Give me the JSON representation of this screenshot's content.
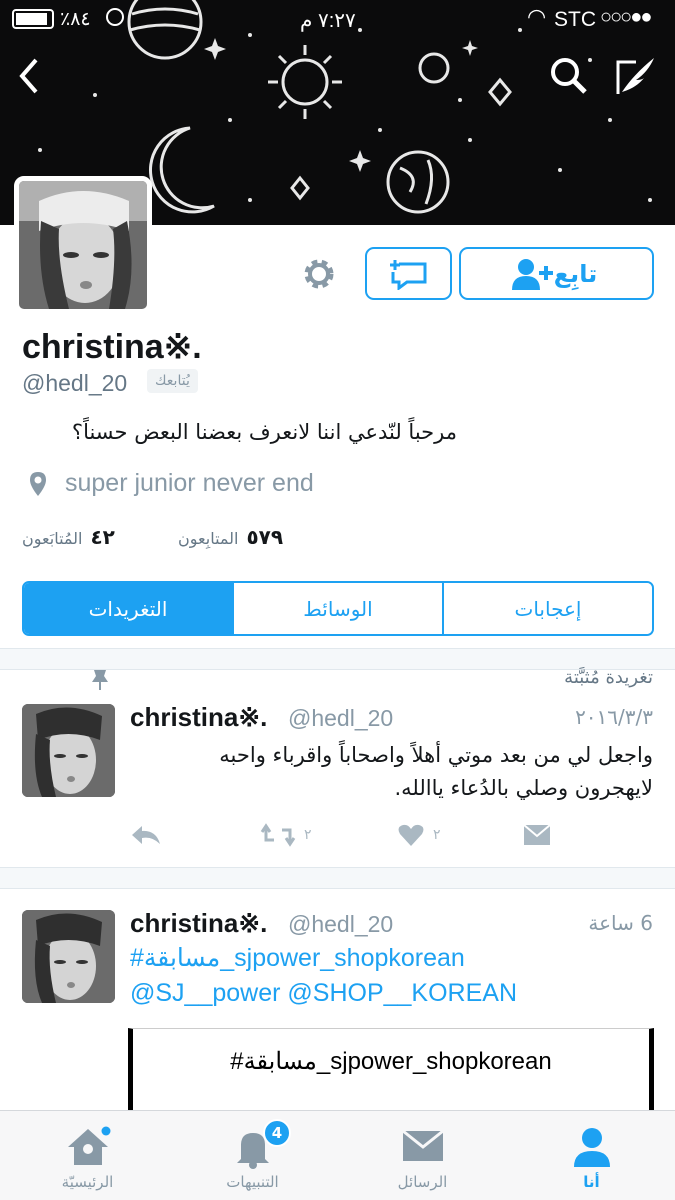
{
  "status_bar": {
    "battery": "٪٨٤",
    "time": "٧:٢٧ م",
    "carrier": "STC"
  },
  "header": {
    "back_icon": "chevron-left-icon",
    "search_icon": "search-icon",
    "compose_icon": "compose-icon"
  },
  "profile": {
    "follow_label": "تابِع",
    "name": "christina※.",
    "handle": "@hedl_20",
    "follows_you": "يُتابعك",
    "bio": "مرحباً لنّدعي اننا لانعرف بعضنا البعض حسناً؟",
    "location": "super junior never end",
    "followers_count": "٥٧٩",
    "followers_label": "المتابِعون",
    "following_count": "٤٢",
    "following_label": "المُتابَعون"
  },
  "tabs": [
    "التغريدات",
    "الوسائط",
    "إعجابات"
  ],
  "pinned": {
    "label": "تغريدة مُثبَّتة",
    "name": "christina※.",
    "handle": "@hedl_20",
    "date": "٢٠١٦/٣/٣",
    "text_line1": "واجعل لي من بعد موتي أهلاً واصحاباً واقرباء واحبه",
    "text_line2": "لايهجرون وصلي بالدُعاء ياالله.",
    "retweets": "٢",
    "likes": "٢"
  },
  "tweet2": {
    "name": "christina※.",
    "handle": "@hedl_20",
    "time": "6 ساعة",
    "hashtag": "#مسابقة_sjpower_shopkorean",
    "mentions": "@SJ__power @SHOP__KOREAN",
    "card_text": "#مسابقة_sjpower_shopkorean"
  },
  "tabbar": {
    "home": "الرئيسيّة",
    "notifications": "التنبيهات",
    "notifications_badge": "4",
    "messages": "الرسائل",
    "me": "أنا"
  },
  "colors": {
    "accent": "#1da1f2",
    "header_bg": "#0b0b0c"
  }
}
